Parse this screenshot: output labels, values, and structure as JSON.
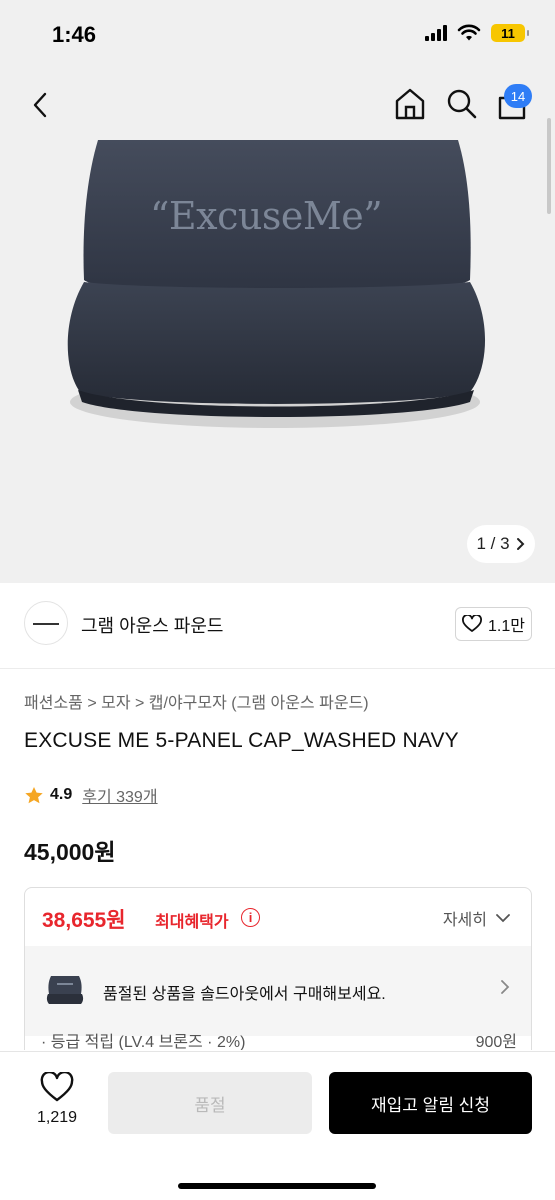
{
  "status_bar": {
    "time": "1:46",
    "battery": "11"
  },
  "nav": {
    "cart_count": "14"
  },
  "product_image": {
    "logo_text": "“ExcuseMe”",
    "pager_label": "1 / 3"
  },
  "brand": {
    "name": "그램 아운스 파운드",
    "likes": "1.1만"
  },
  "breadcrumb": "패션소품 > 모자 > 캡/야구모자 (그램 아운스 파운드)",
  "product": {
    "title": "EXCUSE ME 5-PANEL CAP_WASHED NAVY",
    "rating": "4.9",
    "reviews": "후기 339개",
    "price": "45,000원"
  },
  "benefit": {
    "price": "38,655원",
    "label": "최대혜택가",
    "detail": "자세히",
    "soldout_message": "품절된 상품을 솔드아웃에서 구매해보세요.",
    "clipped_left": "· 등급 적립 (LV.4 브론즈 · 2%)",
    "clipped_right": "900원"
  },
  "bottom_bar": {
    "wish_count": "1,219",
    "soldout_label": "품절",
    "restock_label": "재입고 알림 신청"
  },
  "colors": {
    "accent_red": "#e8262d",
    "badge_blue": "#2f7df6",
    "cap_navy": "#3a4150"
  }
}
